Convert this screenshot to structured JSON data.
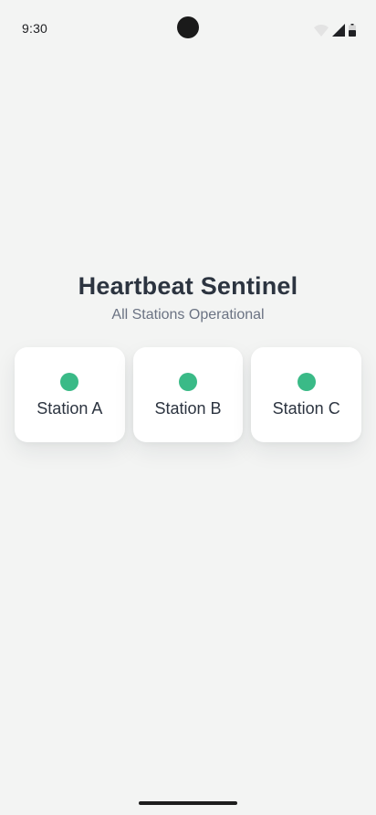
{
  "status_bar": {
    "time": "9:30",
    "icons": [
      "wifi-icon",
      "cellular-signal-icon",
      "battery-icon"
    ]
  },
  "header": {
    "title": "Heartbeat Sentinel",
    "subtitle": "All Stations Operational"
  },
  "stations": [
    {
      "name": "Station A",
      "status": "operational"
    },
    {
      "name": "Station B",
      "status": "operational"
    },
    {
      "name": "Station C",
      "status": "operational"
    }
  ],
  "colors": {
    "background": "#f3f4f3",
    "card": "#ffffff",
    "title": "#2c3440",
    "subtitle": "#6b7383",
    "status_ok": "#3aba87"
  }
}
